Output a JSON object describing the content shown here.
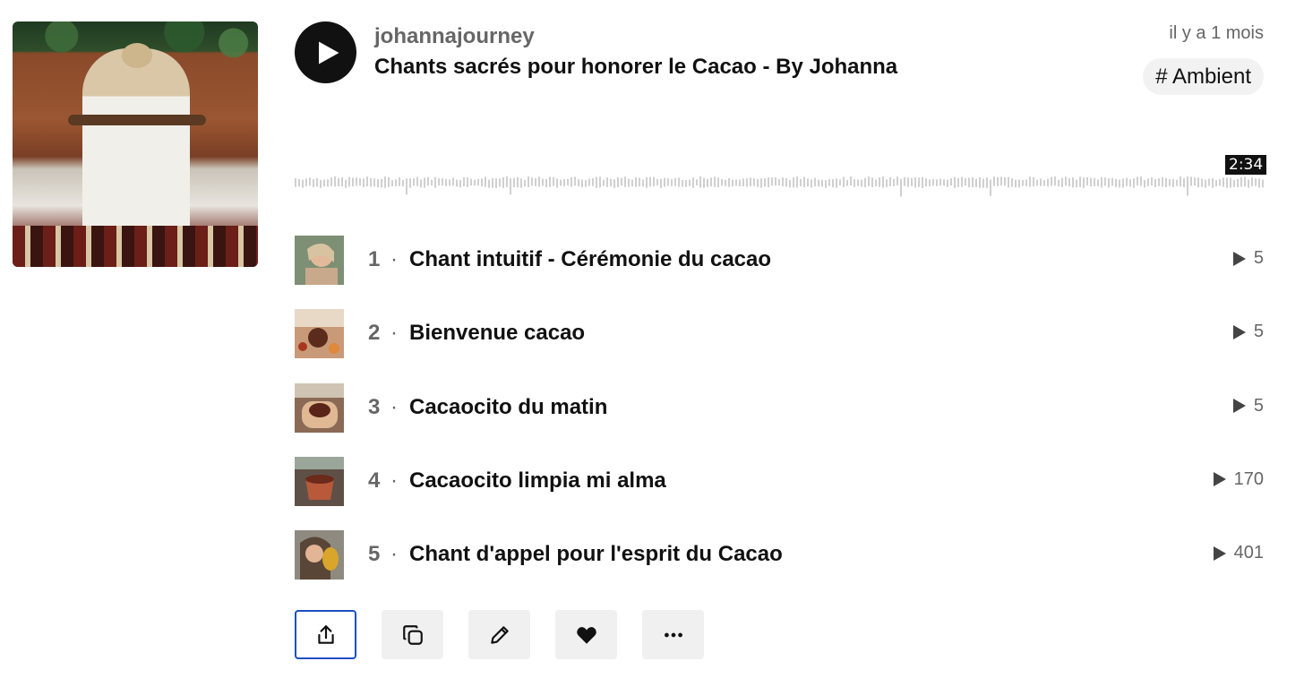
{
  "header": {
    "artist": "johannajourney",
    "title": "Chants sacrés pour honorer le Cacao - By Johanna",
    "time_ago": "il y a 1 mois",
    "tag": "# Ambient",
    "duration": "2:34"
  },
  "tracks": [
    {
      "number": "1",
      "separator": "·",
      "title": "Chant intuitif - Cérémonie du cacao",
      "plays": "5"
    },
    {
      "number": "2",
      "separator": "·",
      "title": "Bienvenue cacao",
      "plays": "5"
    },
    {
      "number": "3",
      "separator": "·",
      "title": "Cacaocito du matin",
      "plays": "5"
    },
    {
      "number": "4",
      "separator": "·",
      "title": "Cacaocito limpia mi alma",
      "plays": "170"
    },
    {
      "number": "5",
      "separator": "·",
      "title": "Chant d'appel pour l'esprit du Cacao",
      "plays": "401"
    }
  ],
  "actions": [
    {
      "icon": "share-icon"
    },
    {
      "icon": "copy-icon"
    },
    {
      "icon": "pencil-icon"
    },
    {
      "icon": "heart-icon"
    },
    {
      "icon": "more-icon"
    }
  ],
  "colors": {
    "primary_text": "#111111",
    "secondary_text": "#666666",
    "button_bg": "#f0f0f0",
    "focus_border": "#1a4fc4"
  }
}
